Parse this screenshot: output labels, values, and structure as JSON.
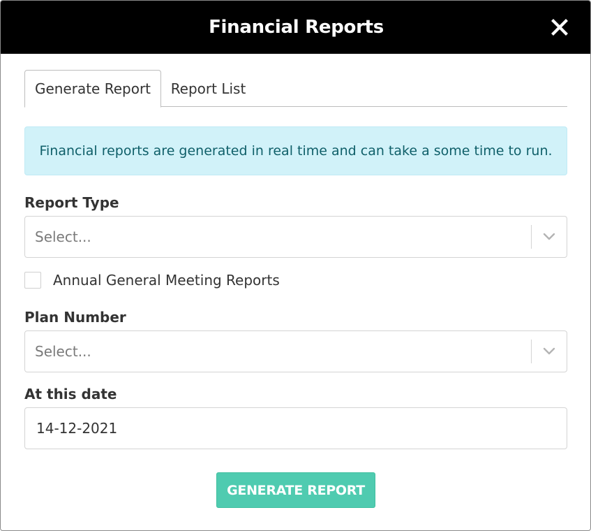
{
  "modal": {
    "title": "Financial Reports",
    "close_icon": "close-icon"
  },
  "tabs": [
    {
      "label": "Generate Report",
      "active": true
    },
    {
      "label": "Report List",
      "active": false
    }
  ],
  "alert": {
    "text": "Financial reports are generated in real time and can take a some time to run."
  },
  "form": {
    "report_type": {
      "label": "Report Type",
      "placeholder": "Select...",
      "icon": "chevron-down-icon"
    },
    "agm_checkbox": {
      "label": "Annual General Meeting Reports",
      "checked": false
    },
    "plan_number": {
      "label": "Plan Number",
      "placeholder": "Select...",
      "icon": "chevron-down-icon"
    },
    "date": {
      "label": "At this date",
      "value": "14-12-2021"
    },
    "submit_label": "GENERATE REPORT"
  },
  "colors": {
    "header_bg": "#000000",
    "alert_bg": "#d1f2f9",
    "alert_text": "#0f5f69",
    "button_bg": "#4fcbb0"
  }
}
